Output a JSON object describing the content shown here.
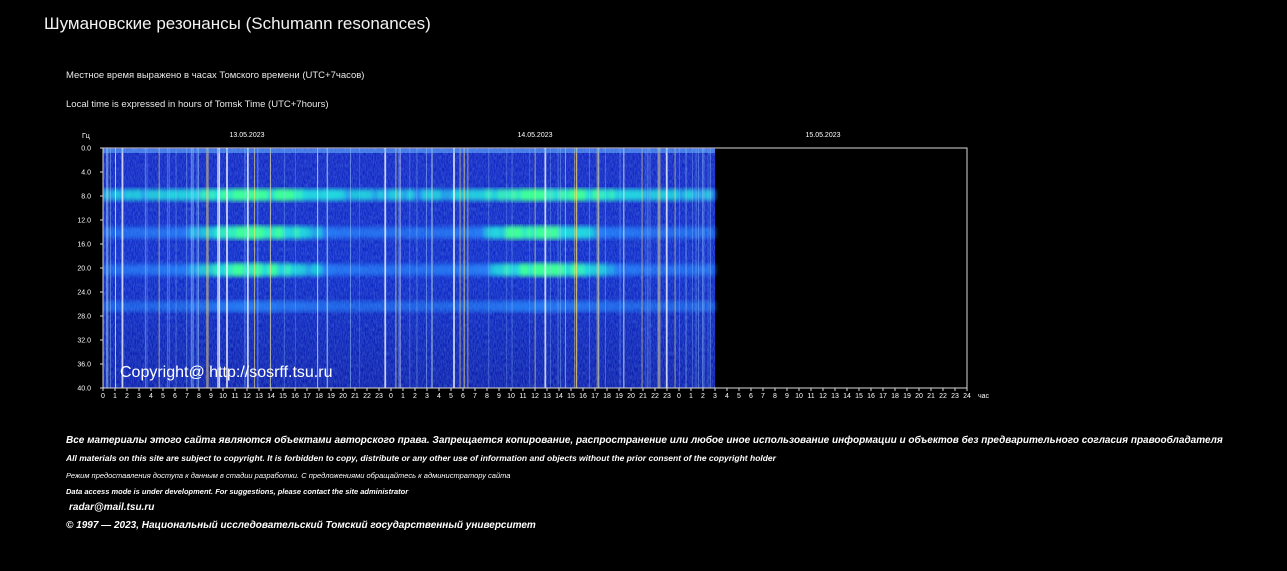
{
  "page": {
    "title": "Шумановские резонансы (Schumann resonances)",
    "note_ru": "Местное время выражено в часах Томского времени (UTC+7часов)",
    "note_en": "Local time is expressed in hours of Tomsk Time (UTC+7hours)"
  },
  "footer": {
    "copyright_ru": "Все материалы этого сайта являются объектами авторского права. Запрещается копирование, распространение или любое иное использование информации и объектов без предварительного согласия правообладателя",
    "copyright_en": "All materials on this site are subject to copyright. It is forbidden to copy, distribute or any other use of information and objects without the prior consent of the copyright holder",
    "access_ru": "Режим предоставления доступа к данным в стадии разработки. С предложениями обращайтесь к администратору сайта",
    "access_en": "Data access mode is under development. For suggestions, please contact the site administrator",
    "email": "radar@mail.tsu.ru",
    "org": "© 1997 — 2023, Национальный исследовательский Томский государственный университет"
  },
  "chart_data": {
    "type": "heatmap",
    "title": "",
    "ylabel": "Гц",
    "xlabel": "час",
    "ylim": [
      0,
      40
    ],
    "y_ticks": [
      "0.0",
      "4.0",
      "8.0",
      "12.0",
      "16.0",
      "20.0",
      "24.0",
      "28.0",
      "32.0",
      "36.0",
      "40.0"
    ],
    "x_ticks": [
      "0",
      "1",
      "2",
      "3",
      "4",
      "5",
      "6",
      "7",
      "8",
      "9",
      "10",
      "11",
      "12",
      "13",
      "14",
      "15",
      "16",
      "17",
      "18",
      "19",
      "20",
      "21",
      "22",
      "23",
      "0",
      "1",
      "2",
      "3",
      "4",
      "5",
      "6",
      "7",
      "8",
      "9",
      "10",
      "11",
      "12",
      "13",
      "14",
      "15",
      "16",
      "17",
      "18",
      "19",
      "20",
      "21",
      "22",
      "23",
      "0",
      "1",
      "2",
      "3",
      "4",
      "5",
      "6",
      "7",
      "8",
      "9",
      "10",
      "11",
      "12",
      "13",
      "14",
      "15",
      "16",
      "17",
      "18",
      "19",
      "20",
      "21",
      "22",
      "23",
      "24"
    ],
    "dates": [
      "13.05.2023",
      "14.05.2023",
      "15.05.2023"
    ],
    "total_hours": 72,
    "data_until_hour": 51,
    "resonance_bands_hz": [
      7.8,
      14.1,
      20.3,
      26.4
    ],
    "watermark": "Copyright@ http://sosrff.tsu.ru",
    "colors": {
      "low": "#0a1aa0",
      "mid": "#1a6bff",
      "high": "#35ff9a",
      "frame": "#d8d8d8",
      "text": "#ffffff"
    }
  }
}
